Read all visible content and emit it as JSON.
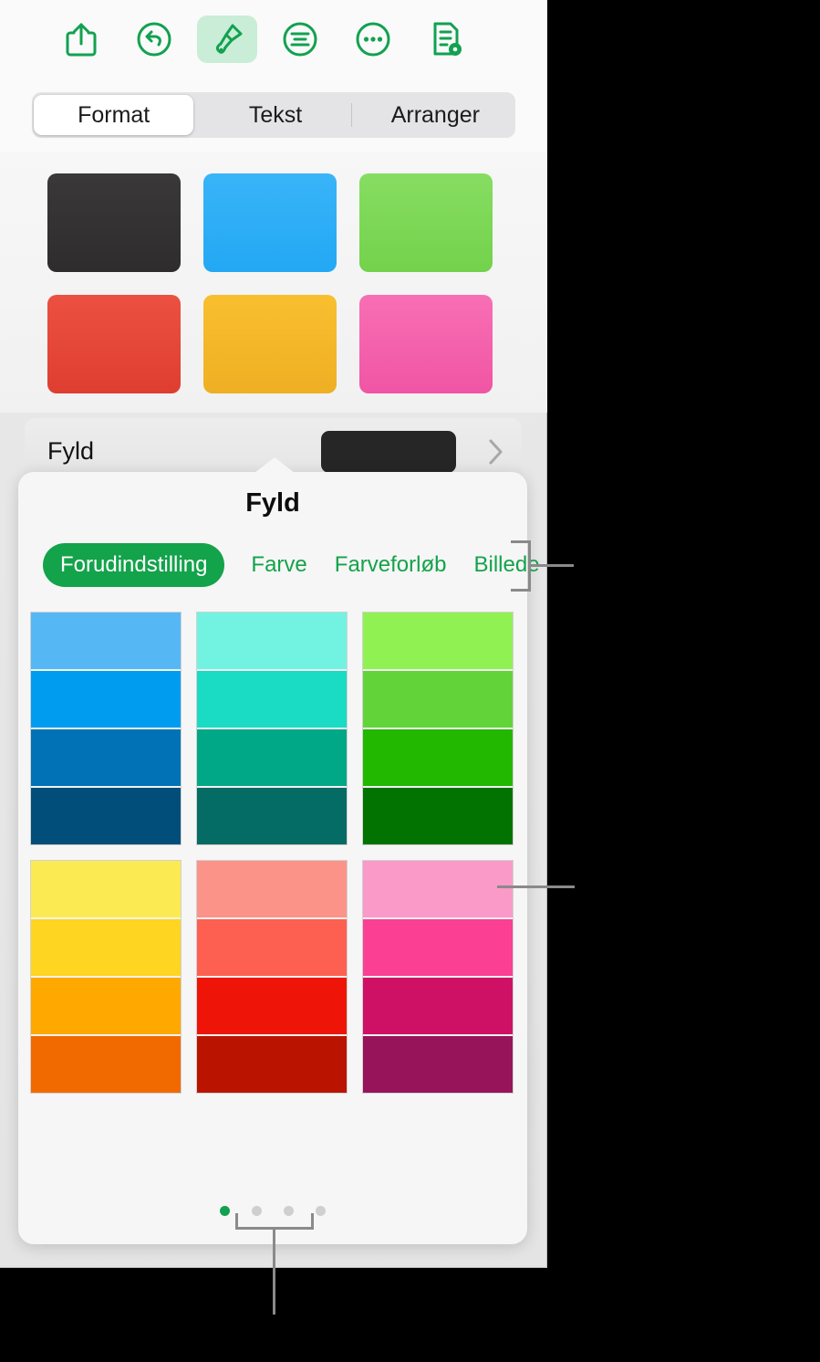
{
  "toolbar": {
    "items": [
      {
        "name": "share-icon",
        "label": "Del",
        "active": false
      },
      {
        "name": "undo-icon",
        "label": "Fortryd",
        "active": false
      },
      {
        "name": "paintbrush-icon",
        "label": "Format",
        "active": true
      },
      {
        "name": "text-format-icon",
        "label": "Tekst",
        "active": false
      },
      {
        "name": "ellipsis-icon",
        "label": "Mere",
        "active": false
      },
      {
        "name": "document-view-icon",
        "label": "Dokument",
        "active": false
      }
    ],
    "active_accent": "#c9edd6",
    "icon_color": "#12a150"
  },
  "segmented": {
    "items": [
      {
        "label": "Format",
        "active": true
      },
      {
        "label": "Tekst",
        "active": false
      },
      {
        "label": "Arranger",
        "active": false
      }
    ]
  },
  "style_presets": {
    "swatches": [
      {
        "name": "preset-dark",
        "color": "#333132",
        "gradient": "linear-gradient(180deg,#3a3839 0%, #2e2c2d 100%)"
      },
      {
        "name": "preset-blue",
        "color": "#2eb0f7",
        "gradient": "linear-gradient(180deg,#39b4f8 0%, #23a8f4 100%)"
      },
      {
        "name": "preset-green",
        "color": "#7ed957",
        "gradient": "linear-gradient(180deg,#87dd62 0%, #73d24b 100%)"
      },
      {
        "name": "preset-red",
        "color": "#e8473a",
        "gradient": "linear-gradient(180deg,#ec5041 0%, #de3e30 100%)"
      },
      {
        "name": "preset-orange",
        "color": "#f5b72c",
        "gradient": "linear-gradient(180deg,#f9bf2f 0%, #efaf24 100%)"
      },
      {
        "name": "preset-pink",
        "color": "#f662ae",
        "gradient": "linear-gradient(180deg,#f86fb4 0%, #f055a4 100%)"
      }
    ]
  },
  "fyld_row": {
    "label": "Fyld",
    "swatch_color": "#262626",
    "chevron": "chevron-right-icon"
  },
  "popover": {
    "title": "Fyld",
    "tabs": [
      {
        "label": "Forudindstilling",
        "active": true
      },
      {
        "label": "Farve",
        "active": false
      },
      {
        "label": "Farveforløb",
        "active": false
      },
      {
        "label": "Billede",
        "active": false
      }
    ],
    "accent_green": "#13a34a",
    "gradient_presets": [
      {
        "name": "blue-gradient",
        "bands": [
          "#55b8f5",
          "#009cf0",
          "#0072b5",
          "#014e7a"
        ]
      },
      {
        "name": "teal-gradient",
        "bands": [
          "#72f3e2",
          "#1adbc4",
          "#00a887",
          "#046b65"
        ]
      },
      {
        "name": "green-gradient",
        "bands": [
          "#90f252",
          "#62d43a",
          "#22b800",
          "#027300"
        ]
      },
      {
        "name": "yellow-gradient",
        "bands": [
          "#fcea52",
          "#fed520",
          "#ffa800",
          "#f06a00"
        ]
      },
      {
        "name": "red-gradient",
        "bands": [
          "#fc9389",
          "#fd6050",
          "#ee1508",
          "#ba1400"
        ]
      },
      {
        "name": "pink-gradient",
        "bands": [
          "#fa9ac8",
          "#fb3f93",
          "#cf1166",
          "#97145b"
        ]
      }
    ],
    "page_dots": {
      "count": 4,
      "active_index": 0,
      "active_color": "#12a150",
      "inactive_color": "#cfcfcf"
    }
  },
  "callouts": [
    {
      "name": "callout-tabs",
      "target": "popover-tabs"
    },
    {
      "name": "callout-pink-swatch",
      "target": "pink-gradient"
    },
    {
      "name": "callout-page-dots",
      "target": "page-dots"
    }
  ]
}
